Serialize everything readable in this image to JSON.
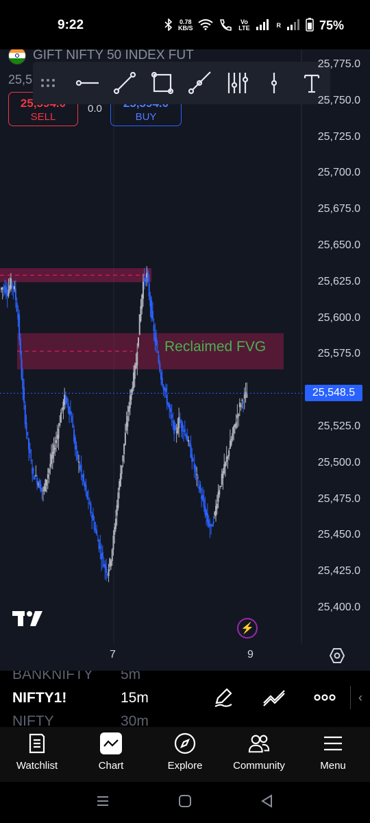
{
  "status_bar": {
    "time": "9:22",
    "network_speed_value": "0.78",
    "network_speed_unit": "KB/S",
    "volte_label": "Vo LTE",
    "r_label": "R",
    "battery": "75%"
  },
  "chart": {
    "symbol_name": "GIFT NIFTY 50 INDEX FUT",
    "last_price_partial": "25,5",
    "sell": {
      "price": "25,594.0",
      "label": "SELL"
    },
    "spread": "0.0",
    "buy": {
      "price": "25,594.0",
      "label": "BUY"
    },
    "price_axis": [
      "25,775.0",
      "25,750.0",
      "25,725.0",
      "25,700.0",
      "25,675.0",
      "25,650.0",
      "25,625.0",
      "25,600.0",
      "25,575.0",
      "25,548.5",
      "25,525.0",
      "25,500.0",
      "25,475.0",
      "25,450.0",
      "25,425.0",
      "25,400.0"
    ],
    "price_axis_values": [
      25775,
      25750,
      25725,
      25700,
      25675,
      25650,
      25625,
      25600,
      25575,
      25525,
      25500,
      25475,
      25450,
      25425,
      25400
    ],
    "current_price": "25,548.5",
    "fvg_label": "Reclaimed FVG",
    "time_axis": [
      "7",
      "9"
    ],
    "colors": {
      "up": "#b2b5be",
      "down": "#2962ff",
      "zone": "#e91e63",
      "fvg_text": "#4caf50",
      "background": "#131722"
    }
  },
  "chart_data": {
    "type": "candlestick",
    "y_range": [
      25395,
      25785
    ],
    "current_price": 25548.5,
    "zones": [
      {
        "name": "upper-zone",
        "from": 25628,
        "to": 25632
      },
      {
        "name": "Reclaimed FVG",
        "from": 25565,
        "to": 25590
      }
    ],
    "close_path": [
      25620,
      25622,
      25618,
      25625,
      25620,
      25600,
      25560,
      25530,
      25510,
      25495,
      25490,
      25485,
      25480,
      25490,
      25500,
      25510,
      25520,
      25535,
      25545,
      25540,
      25530,
      25510,
      25500,
      25490,
      25480,
      25470,
      25460,
      25450,
      25440,
      25430,
      25425,
      25435,
      25455,
      25480,
      25500,
      25520,
      25540,
      25555,
      25570,
      25600,
      25625,
      25630,
      25610,
      25590,
      25575,
      25560,
      25550,
      25540,
      25530,
      25520,
      25530,
      25525,
      25520,
      25510,
      25500,
      25490,
      25480,
      25470,
      25460,
      25455,
      25465,
      25480,
      25490,
      25500,
      25510,
      25520,
      25530,
      25540,
      25545,
      25548
    ]
  },
  "drawing_toolbar": {
    "tools": [
      "horizontal-line-tool-icon",
      "trend-line-tool-icon",
      "rectangle-tool-icon",
      "ray-tool-icon",
      "fib-tool-icon",
      "vertical-line-tool-icon",
      "text-tool-icon"
    ]
  },
  "picker": {
    "symbols": [
      "BANKNIFTY",
      "NIFTY1!",
      "NIFTY"
    ],
    "intervals": [
      "5m",
      "15m",
      "30m"
    ]
  },
  "bottom_nav": {
    "items": [
      {
        "label": "Watchlist"
      },
      {
        "label": "Chart"
      },
      {
        "label": "Explore"
      },
      {
        "label": "Community"
      },
      {
        "label": "Menu"
      }
    ]
  }
}
